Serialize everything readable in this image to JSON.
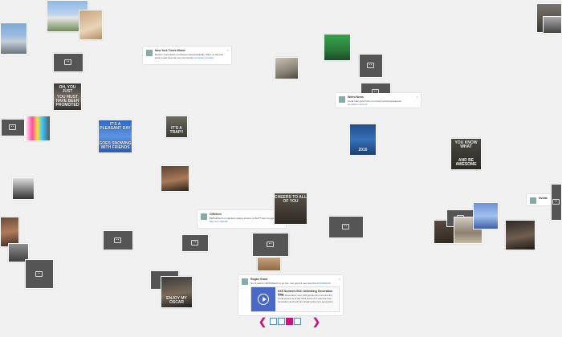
{
  "colors": {
    "background": "#f1f1f1",
    "placeholder": "#555555",
    "accent": "#c2187a",
    "link": "#3a7ac0"
  },
  "meme_captions": {
    "m1": {
      "top": "OH, YOU JUST",
      "bottom": "YOU MUST HAVE BEEN PROMOTED"
    },
    "m2": {
      "top": "IT'S A PLEASANT DAY",
      "bottom": "GOES SNOWING WITH FRIENDS"
    },
    "m3": {
      "top": "",
      "bottom": "IT'S A TRAP!!"
    },
    "m4": {
      "top": "",
      "bottom": "2016"
    },
    "m5": {
      "top": "CHEERS TO ALL OF YOU",
      "bottom": ""
    },
    "m6": {
      "top": "",
      "bottom": "ENJOY MY OSCAR"
    },
    "m7": {
      "top": "YOU KNOW WHAT",
      "bottom": "AND BE AWESOME"
    }
  },
  "tweets": {
    "t1": {
      "name": "New York Times World",
      "text": "Report: Coronavirus continues spread globally; Many at risk just want to ask how can our community",
      "link": "pic.twitter.com/abc"
    },
    "t2": {
      "name": "Weird News",
      "text": "Local man gets frozen in record cold temperatures",
      "link": "pic.twitter.com/xyz"
    },
    "t3": {
      "name": "CNNtech",
      "text": "#WhatsTech on Hackers selling access to WoT? Ask not again",
      "link": "http://cnn.it/2eRb"
    },
    "t4": {
      "name": "Nvidia",
      "text": "Our new GPU is here",
      "link": ""
    },
    "t5": {
      "name": "Pope Francis",
      "text": "Let us pray for peace",
      "link": ""
    },
    "t6": {
      "name": "Rogan Grant",
      "text": "So I'll wait for #SXSWtech to go live. Get good & see how this",
      "link": "#SXSW2016",
      "card_title": "SXS Summit 2016: Unlimiting Generation Gap",
      "card_desc": "On 12 December, over 100 people from around the world joined us at the SXS Summit to discuss how innovation and tech are shaping the new generation"
    }
  },
  "icons": {
    "placeholder": "broken-image-icon",
    "play": "play-icon",
    "prev": "chevron-left-icon",
    "next": "chevron-right-icon"
  },
  "pager": {
    "prev": "❮",
    "next": "❯",
    "pages": 4,
    "active_page": 3
  }
}
